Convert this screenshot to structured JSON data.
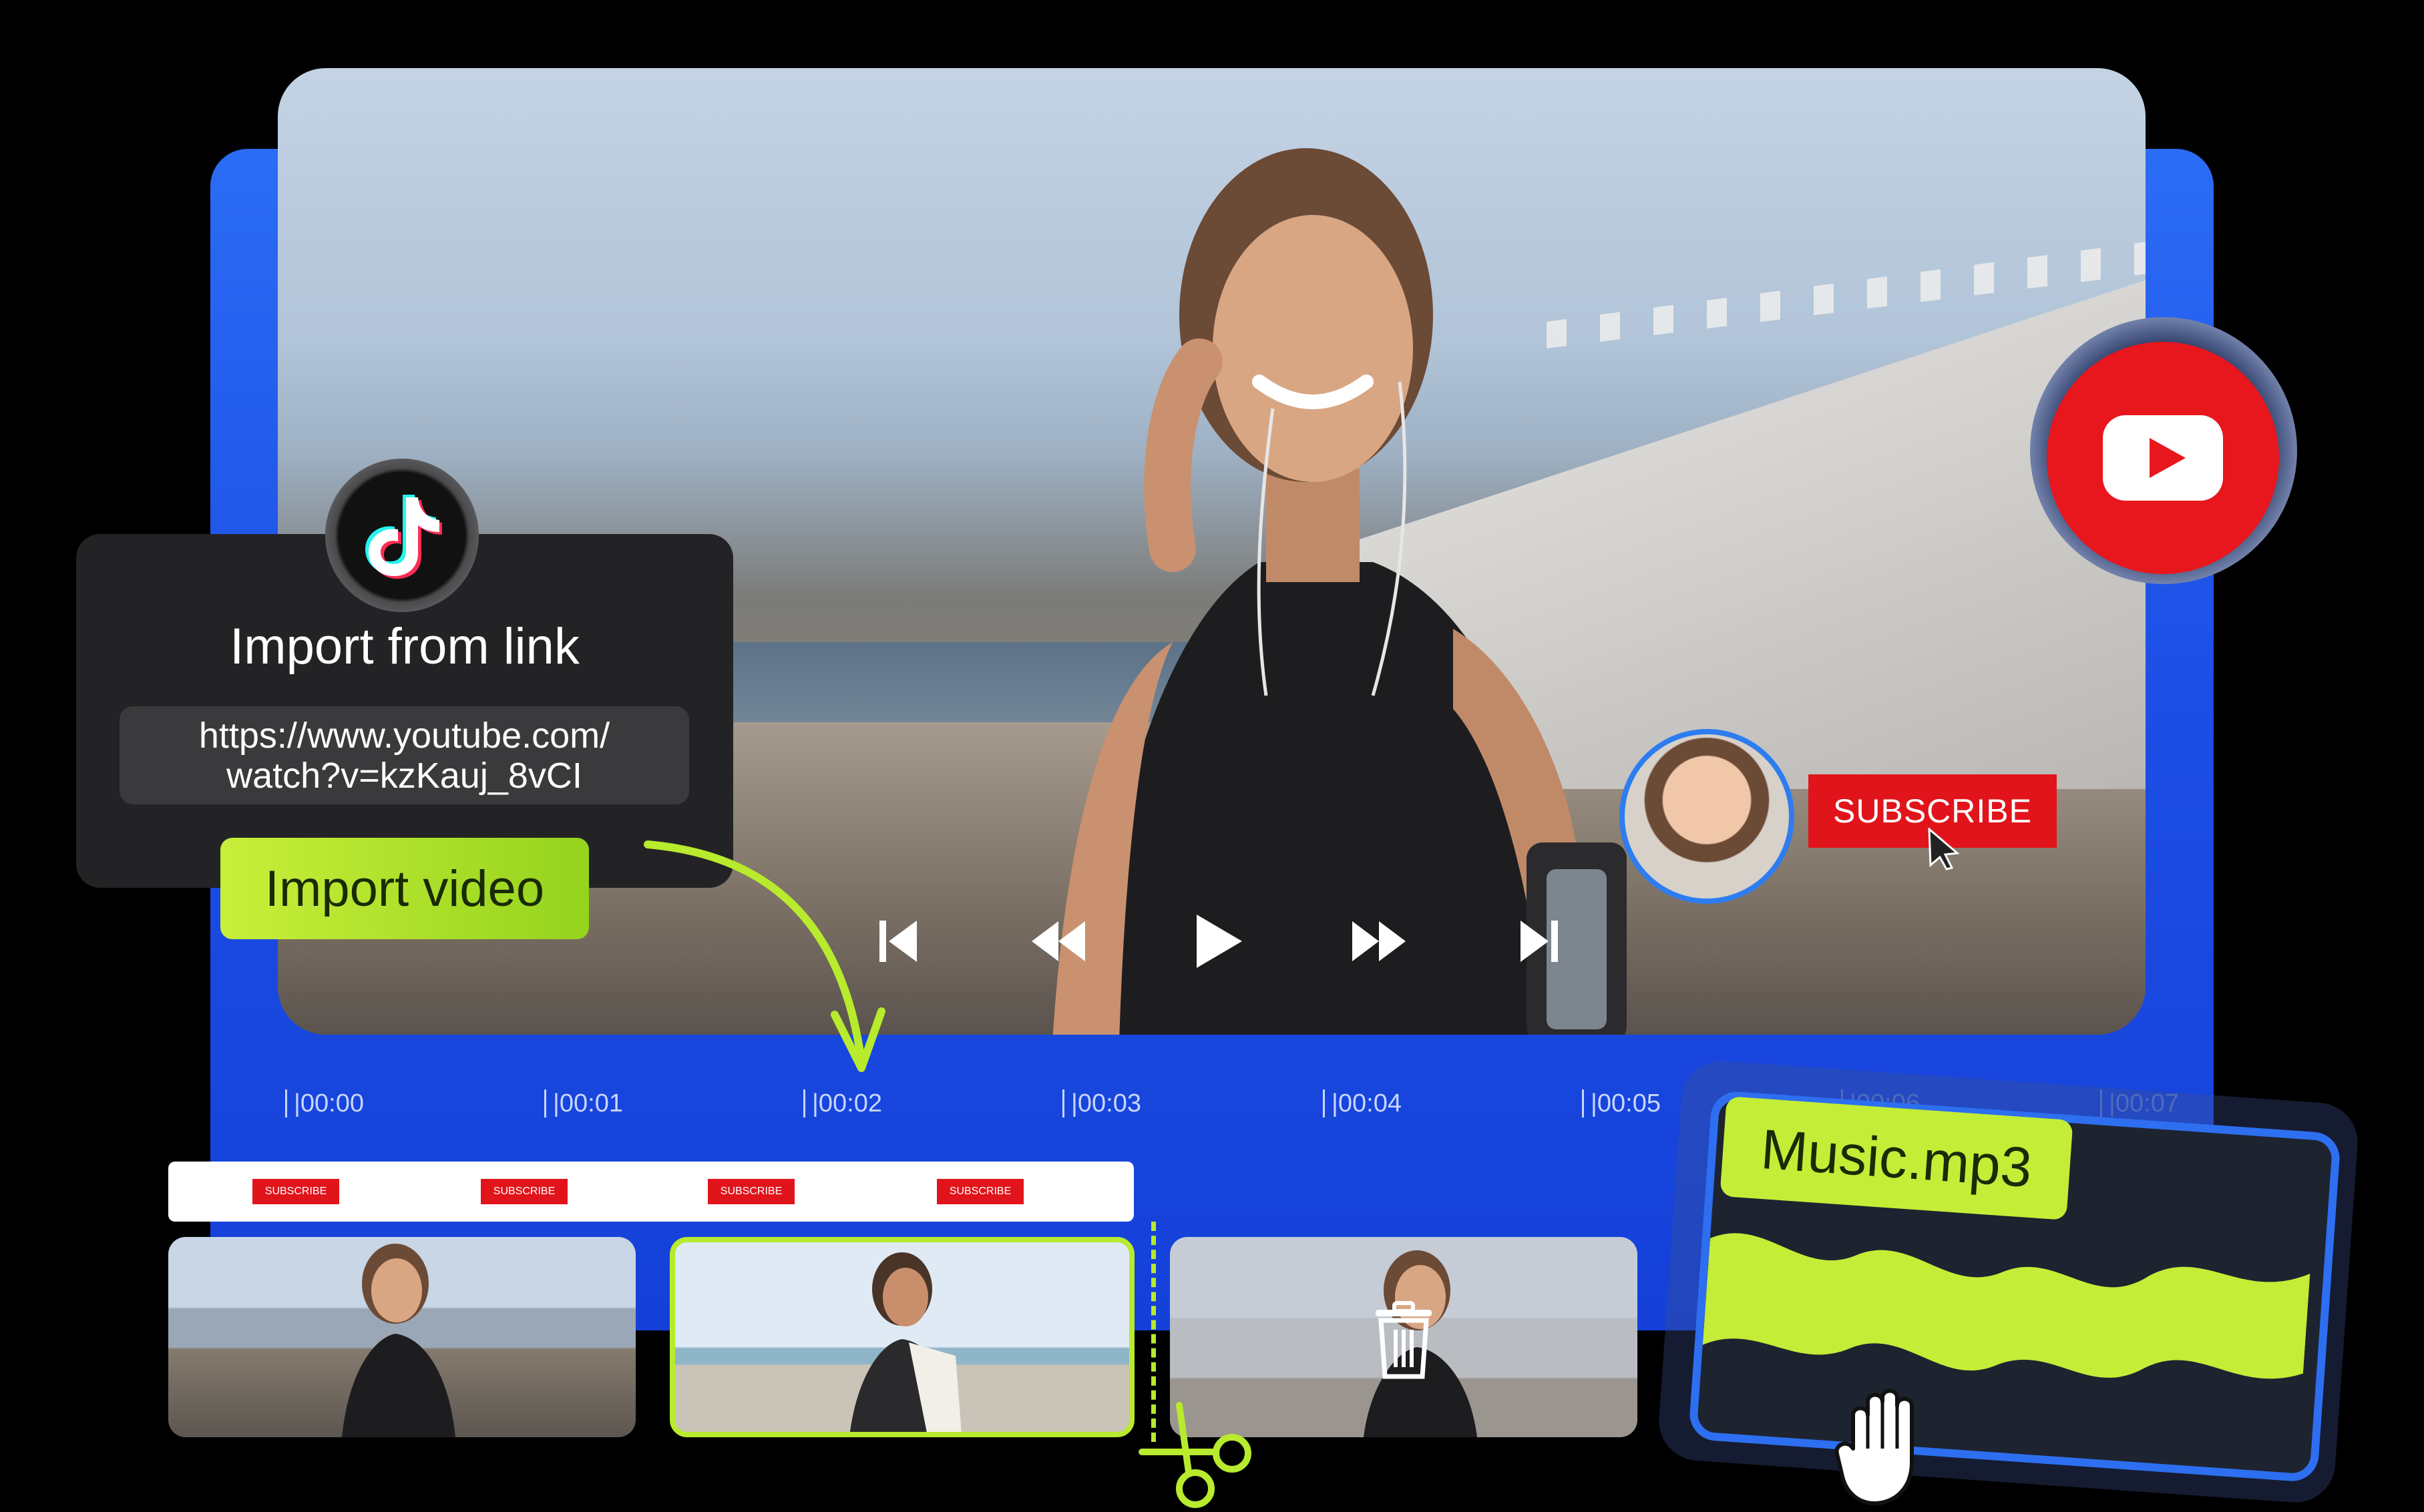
{
  "player": {
    "controls": [
      {
        "name": "skip-back-icon"
      },
      {
        "name": "rewind-icon"
      },
      {
        "name": "play-icon"
      },
      {
        "name": "fast-forward-icon"
      },
      {
        "name": "skip-forward-icon"
      }
    ],
    "subscribe_label": "SUBSCRIBE"
  },
  "import_panel": {
    "title": "Import from link",
    "url_line1": "https://www.youtube.com/",
    "url_line2": "watch?v=kzKauj_8vCI",
    "button_label": "Import video"
  },
  "timeline": {
    "ticks": [
      "|00:00",
      "|00:01",
      "|00:02",
      "|00:03",
      "|00:04",
      "|00:05",
      "|00:06",
      "|00:07"
    ],
    "subtitle_clips": [
      "SUBSCRIBE",
      "SUBSCRIBE",
      "SUBSCRIBE",
      "SUBSCRIBE"
    ]
  },
  "music": {
    "filename": "Music.mp3"
  },
  "colors": {
    "accent_blue": "#1d4fe6",
    "accent_green": "#b8ea2e",
    "youtube_red": "#e8161d"
  }
}
